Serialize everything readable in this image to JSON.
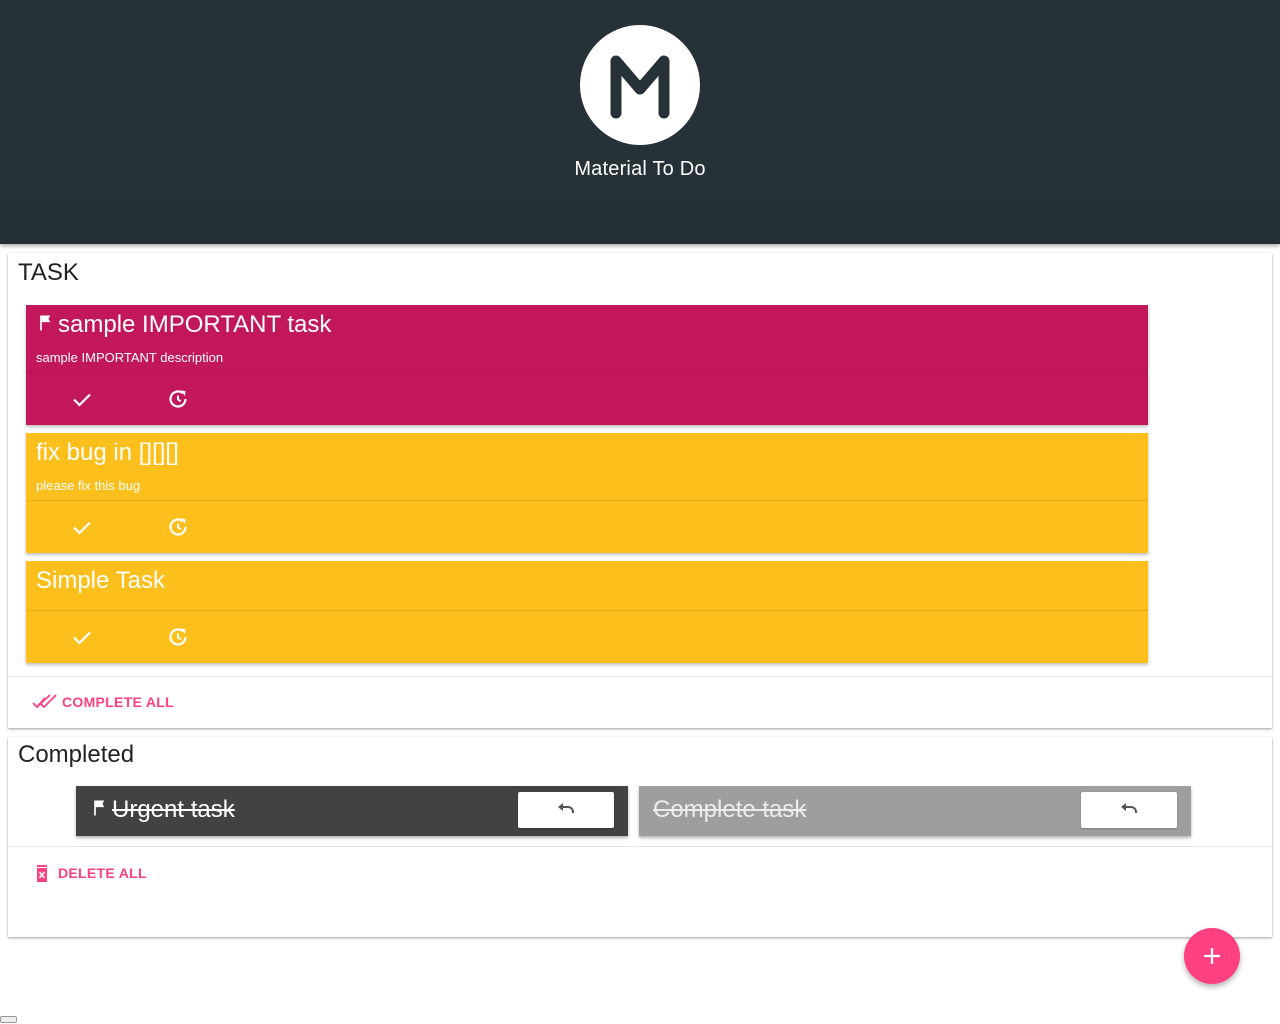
{
  "app": {
    "title": "Material To Do",
    "logo_letter": "M"
  },
  "tasks_section": {
    "title": "TASK",
    "items": [
      {
        "title": "sample IMPORTANT task",
        "description": "sample IMPORTANT description",
        "important": true,
        "color": "#c2185b"
      },
      {
        "title": "fix bug in [][][]",
        "description": "please fix this bug",
        "important": false,
        "color": "#fcbf1b"
      },
      {
        "title": "Simple Task",
        "description": "",
        "important": false,
        "color": "#fcbf1b"
      }
    ],
    "complete_all_label": "COMPLETE ALL"
  },
  "completed_section": {
    "title": "Completed",
    "items": [
      {
        "title": "Urgent task",
        "important": true,
        "color": "#424242",
        "text_color": "#ffffff"
      },
      {
        "title": "Complete task",
        "important": false,
        "color": "#9e9e9e",
        "text_color": "#ececec"
      }
    ],
    "delete_all_label": "DELETE ALL"
  },
  "icons": {
    "flag": "flag-icon",
    "check": "check-icon",
    "snooze": "restore-icon",
    "undo": "undo-icon",
    "double_check": "done-all-icon",
    "delete": "delete-icon",
    "add": "add-icon"
  },
  "colors": {
    "header": "#263238",
    "accent": "#ff4081",
    "important": "#c2185b",
    "normal": "#fcbf1b"
  }
}
